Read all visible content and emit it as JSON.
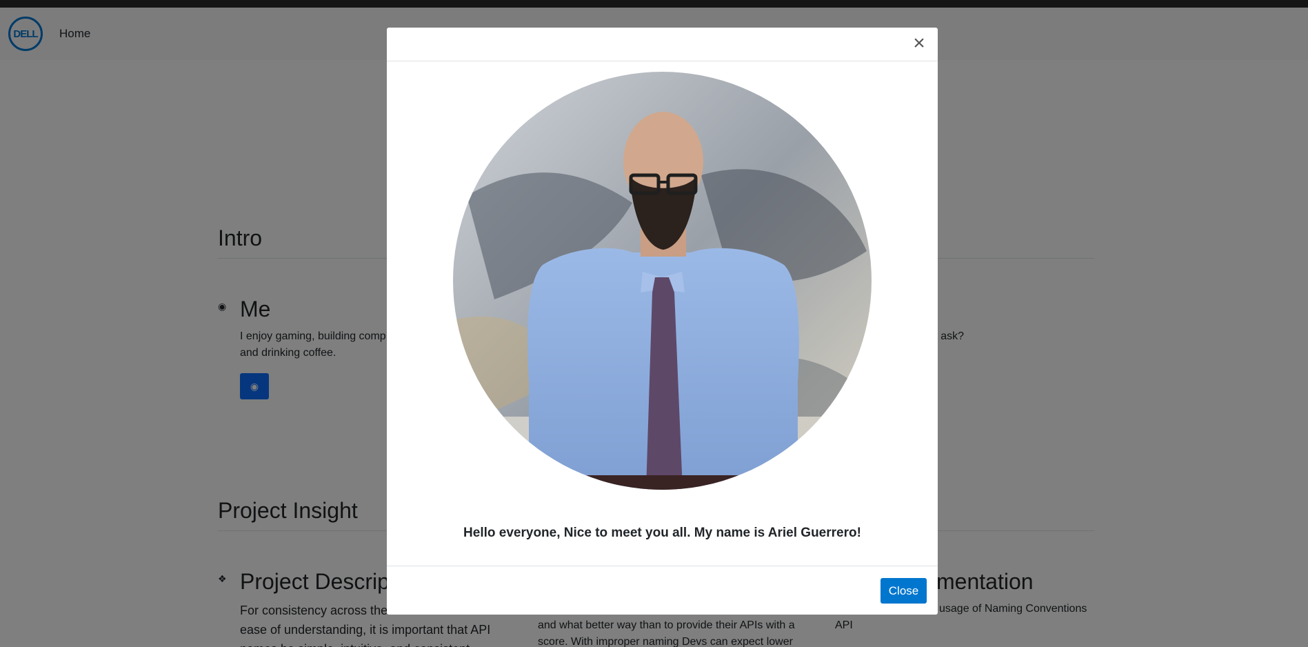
{
  "navbar": {
    "logo_text": "DELL",
    "home_label": "Home"
  },
  "sections": {
    "intro_title": "Intro",
    "project_insight_title": "Project Insight"
  },
  "cards": {
    "me": {
      "title": "Me",
      "text_line1": "I enjoy gaming, building comp",
      "text_line2": "and drinking coffee."
    },
    "right_partial_text": "ou ask?",
    "project_description": {
      "title": "Project Descrip",
      "text_line1": "For consistency across the",
      "text_line2": "ease of understanding, it is important that API",
      "text_line3": "names be simple, intuitive, and consistent."
    },
    "middle": {
      "text_line1": "and what better way than to provide their APIs with a",
      "text_line2": "score. With improper naming Devs can expect lower"
    },
    "implementation": {
      "title": "mentation",
      "text_line1": "usage of Naming Conventions",
      "text_line2": "API"
    }
  },
  "modal": {
    "message": "Hello everyone, Nice to meet you all. My name is Ariel Guerrero!",
    "close_icon": "close-icon",
    "close_button_label": "Close",
    "photo": "portrait-photo"
  },
  "colors": {
    "accent": "#0076ce",
    "backdrop": "rgba(0,0,0,0.5)"
  }
}
